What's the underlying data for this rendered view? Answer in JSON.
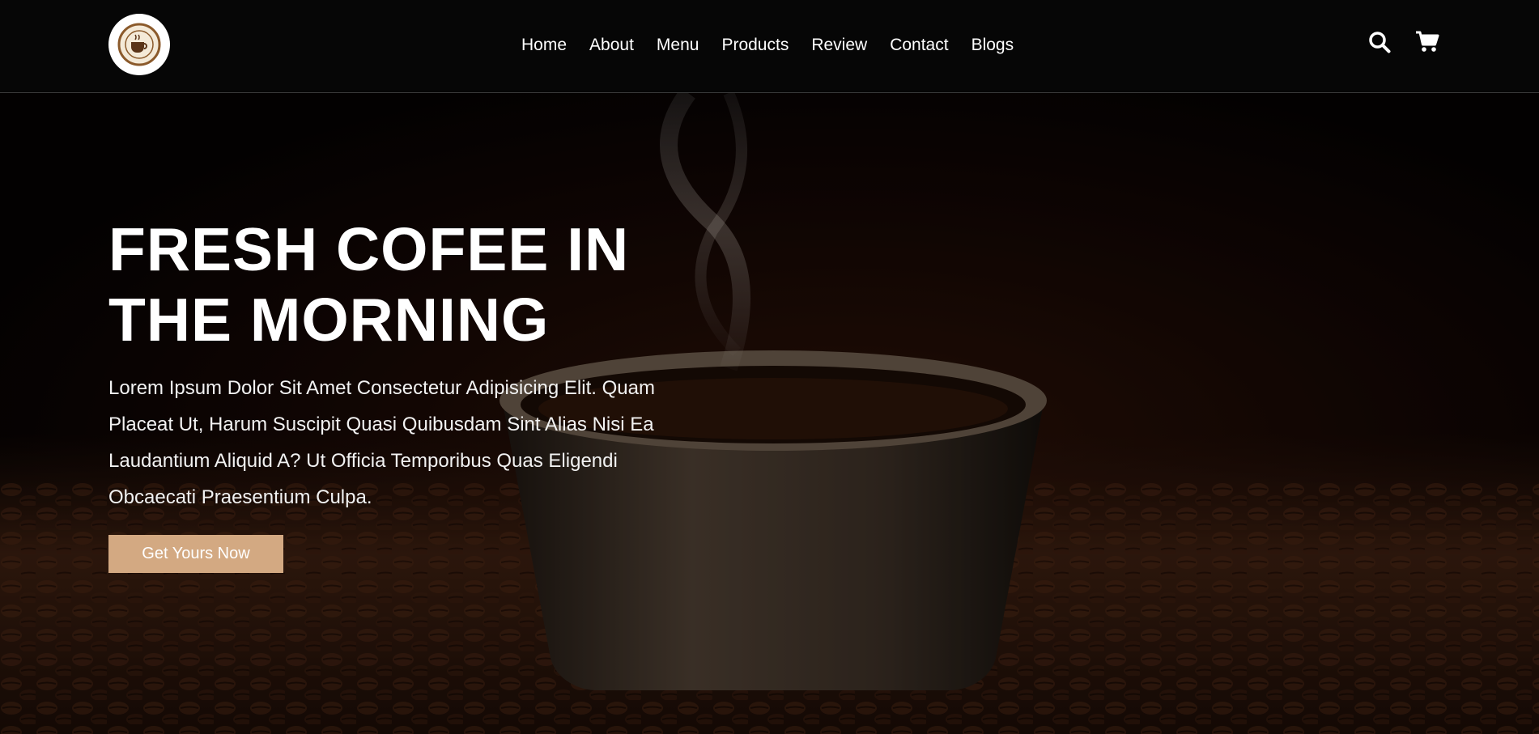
{
  "nav": {
    "links": [
      "Home",
      "About",
      "Menu",
      "Products",
      "Review",
      "Contact",
      "Blogs"
    ]
  },
  "icons": {
    "logo": "coffee-logo-icon",
    "search": "search-icon",
    "cart": "shopping-cart-icon"
  },
  "hero": {
    "title_line1": "FRESH COFEE IN",
    "title_line2": "THE MORNING",
    "description": "Lorem Ipsum Dolor Sit Amet Consectetur Adipisicing Elit. Quam Placeat Ut, Harum Suscipit Quasi Quibusdam Sint Alias Nisi Ea Laudantium Aliquid A? Ut Officia Temporibus Quas Eligendi Obcaecati Praesentium Culpa.",
    "cta_label": "Get Yours Now"
  },
  "colors": {
    "header_bg": "#060606",
    "accent": "#d3a982",
    "text": "#ffffff"
  }
}
